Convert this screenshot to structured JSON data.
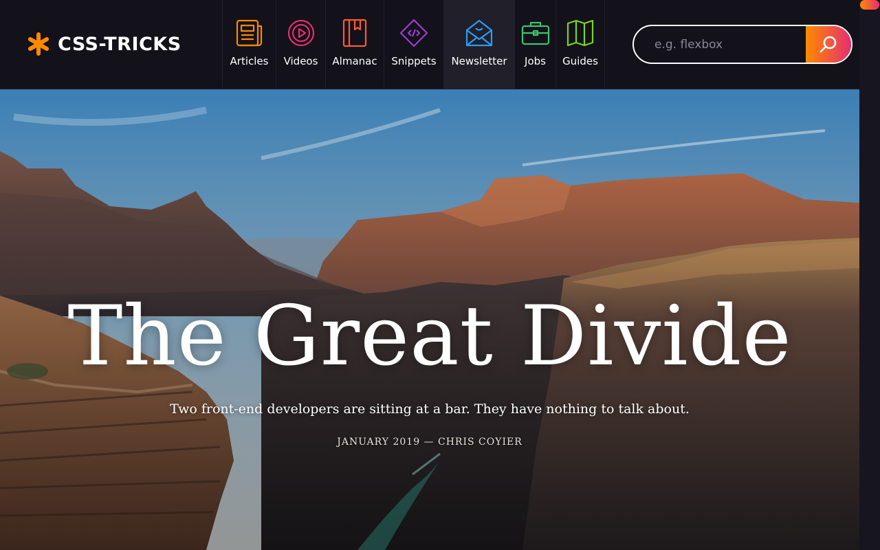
{
  "site": {
    "logo_text": "CSS-TRICKS",
    "accent": "#ff8a00",
    "accent2": "#e52e71"
  },
  "nav": {
    "items": [
      {
        "label": "Articles",
        "icon": "newspaper-icon",
        "color": "#ff8a00"
      },
      {
        "label": "Videos",
        "icon": "play-circle-icon",
        "color": "#e52e71"
      },
      {
        "label": "Almanac",
        "icon": "book-icon",
        "color": "#ff5a36"
      },
      {
        "label": "Snippets",
        "icon": "code-diamond-icon",
        "color": "#9b3fd1"
      },
      {
        "label": "Newsletter",
        "icon": "envelope-icon",
        "color": "#2a9df4"
      },
      {
        "label": "Jobs",
        "icon": "briefcase-icon",
        "color": "#3ec46d"
      },
      {
        "label": "Guides",
        "icon": "map-icon",
        "color": "#7ed321"
      }
    ],
    "active": "Newsletter"
  },
  "search": {
    "placeholder": "e.g. flexbox",
    "button_icon": "search-icon"
  },
  "hero": {
    "title": "The Great Divide",
    "subtitle": "Two front-end developers are sitting at a bar. They have nothing to talk about.",
    "meta": "JANUARY 2019 — CHRIS COYIER"
  }
}
